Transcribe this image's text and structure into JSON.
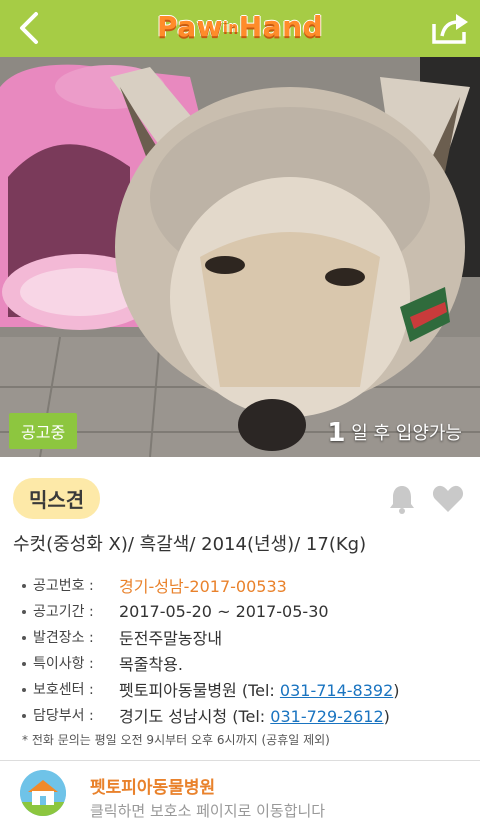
{
  "header": {
    "logo_main": "Paw",
    "logo_small": "in",
    "logo_end": "Hand",
    "back_icon": "back-arrow-icon",
    "share_icon": "share-icon",
    "bar_color": "#a6cc45"
  },
  "photo": {
    "status_badge": "공고중",
    "adopt_num": "1",
    "adopt_text": " 일 후 입양가능"
  },
  "animal": {
    "breed": "믹스견",
    "summary": "수컷(중성화 X)/ 흑갈색/ 2014(년생)/ 17(Kg)"
  },
  "info": {
    "notice_no_label": "공고번호 :",
    "notice_no": "경기-성남-2017-00533",
    "period_label": "공고기간 :",
    "period": "2017-05-20 ~ 2017-05-30",
    "place_label": "발견장소 :",
    "place": "둔전주말농장내",
    "feature_label": "특이사항 :",
    "feature": "목줄착용.",
    "center_label": "보호센터 :",
    "center": "펫토피아동물병원 (Tel: ",
    "center_tel": "031-714-8392",
    "center_close": ")",
    "office_label": "담당부서 :",
    "office": "경기도 성남시청 (Tel: ",
    "office_tel": "031-729-2612",
    "office_close": ")"
  },
  "note": "* 전화 문의는 평일 오전 9시부터 오후 6시까지 (공휴일 제외)",
  "shelter": {
    "name": "펫토피아동물병원",
    "hint": "클릭하면 보호소 페이지로 이동합니다"
  }
}
